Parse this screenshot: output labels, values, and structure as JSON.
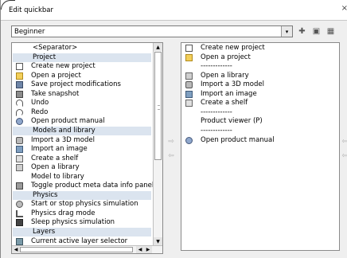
{
  "window": {
    "title": "Edit quickbar",
    "close_glyph": "×"
  },
  "combo": {
    "value": "Beginner",
    "arrow": "▾"
  },
  "toolbar": [
    {
      "name": "add-icon",
      "glyph": "✚"
    },
    {
      "name": "copy-icon",
      "glyph": "▣"
    },
    {
      "name": "grid-icon",
      "glyph": "▦"
    }
  ],
  "available_list": {
    "rows": [
      {
        "text": "<Separator>",
        "kind": "sep",
        "icon": ""
      },
      {
        "text": "Project",
        "kind": "header",
        "icon": ""
      },
      {
        "text": "Create new project",
        "kind": "item",
        "icon": "doc"
      },
      {
        "text": "Open a project",
        "kind": "item",
        "icon": "folder"
      },
      {
        "text": "Save project modifications",
        "kind": "item",
        "icon": "save"
      },
      {
        "text": "Take snapshot",
        "kind": "item",
        "icon": "snap"
      },
      {
        "text": "Undo",
        "kind": "item",
        "icon": "undo"
      },
      {
        "text": "Redo",
        "kind": "item",
        "icon": "redo"
      },
      {
        "text": "Open product manual",
        "kind": "item",
        "icon": "manual"
      },
      {
        "text": "Models and library",
        "kind": "header",
        "icon": ""
      },
      {
        "text": "Import a 3D model",
        "kind": "item",
        "icon": "model"
      },
      {
        "text": "Import an image",
        "kind": "item",
        "icon": "image"
      },
      {
        "text": "Create a shelf",
        "kind": "item",
        "icon": "shelf"
      },
      {
        "text": "Open a library",
        "kind": "item",
        "icon": "library"
      },
      {
        "text": "Model to library",
        "kind": "item",
        "icon": ""
      },
      {
        "text": "Toggle product meta data info panel",
        "kind": "item",
        "icon": "toggle"
      },
      {
        "text": "Physics",
        "kind": "header",
        "icon": ""
      },
      {
        "text": "Start or stop physics simulation",
        "kind": "item",
        "icon": "gear"
      },
      {
        "text": "Physics drag mode",
        "kind": "item",
        "icon": "drag"
      },
      {
        "text": "Sleep physics simulation",
        "kind": "item",
        "icon": "sleep"
      },
      {
        "text": "Layers",
        "kind": "header",
        "icon": ""
      },
      {
        "text": "Current active layer selector",
        "kind": "item",
        "icon": "layer"
      }
    ]
  },
  "quickbar_list": {
    "rows": [
      {
        "text": "Create new project",
        "icon": "doc"
      },
      {
        "text": "Open a project",
        "icon": "folder"
      },
      {
        "text": "-------------",
        "icon": ""
      },
      {
        "text": "Open a library",
        "icon": "library"
      },
      {
        "text": "Import a 3D model",
        "icon": "model"
      },
      {
        "text": "Import an image",
        "icon": "image"
      },
      {
        "text": "Create a shelf",
        "icon": "shelf"
      },
      {
        "text": "-------------",
        "icon": ""
      },
      {
        "text": "Product viewer (P)",
        "icon": ""
      },
      {
        "text": "-------------",
        "icon": ""
      },
      {
        "text": "Open product manual",
        "icon": "manual"
      }
    ]
  },
  "arrows": {
    "right": "⇨",
    "left": "⇦",
    "up": "▲",
    "down": "▼",
    "scroll_left": "◀",
    "scroll_right": "▶"
  }
}
